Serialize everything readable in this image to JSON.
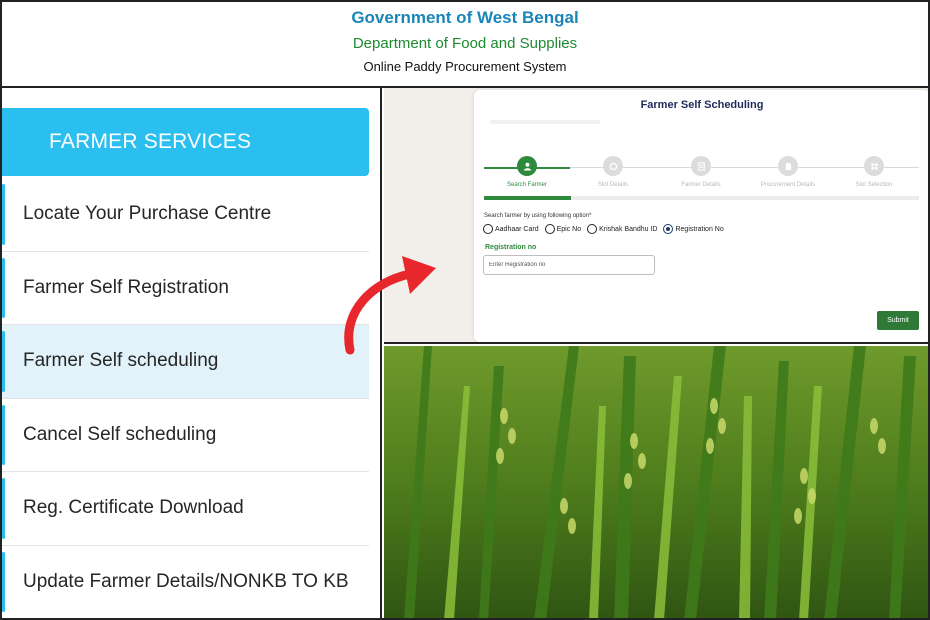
{
  "header": {
    "gov": "Government of West Bengal",
    "dept": "Department of Food and Supplies",
    "system": "Online Paddy Procurement System"
  },
  "services": {
    "title": "FARMER SERVICES",
    "items": [
      {
        "label": "Locate Your Purchase Centre"
      },
      {
        "label": "Farmer Self Registration"
      },
      {
        "label": "Farmer Self scheduling",
        "active": true
      },
      {
        "label": "Cancel Self scheduling"
      },
      {
        "label": "Reg. Certificate Download"
      },
      {
        "label": "Update Farmer Details/NONKB TO KB"
      }
    ]
  },
  "form": {
    "title": "Farmer Self Scheduling",
    "steps": [
      {
        "label": "Search Farmer",
        "icon": "person-icon"
      },
      {
        "label": "Slot Details",
        "icon": "clock-icon"
      },
      {
        "label": "Farmer Details",
        "icon": "document-icon"
      },
      {
        "label": "Procurement Details",
        "icon": "file-icon"
      },
      {
        "label": "Slot Selection",
        "icon": "grid-icon"
      }
    ],
    "progress_fraction": 0.2,
    "option_label": "Search farmer by using following option*",
    "options": [
      "Aadhaar Card",
      "Epic No",
      "Krishak Bandhu ID",
      "Registration No"
    ],
    "selected_option": "Registration No",
    "field_label": "Registration no",
    "field_placeholder": "Enter Registration no",
    "submit_label": "Submit"
  },
  "colors": {
    "gov_blue": "#1a86b8",
    "dept_green": "#1d8a2f",
    "service_blue": "#2bbff0",
    "active_item_bg": "#e1f2fb",
    "form_green": "#2f8a3d",
    "arrow_red": "#e8272d"
  },
  "image": {
    "subject": "rice-paddy-field-photo"
  }
}
